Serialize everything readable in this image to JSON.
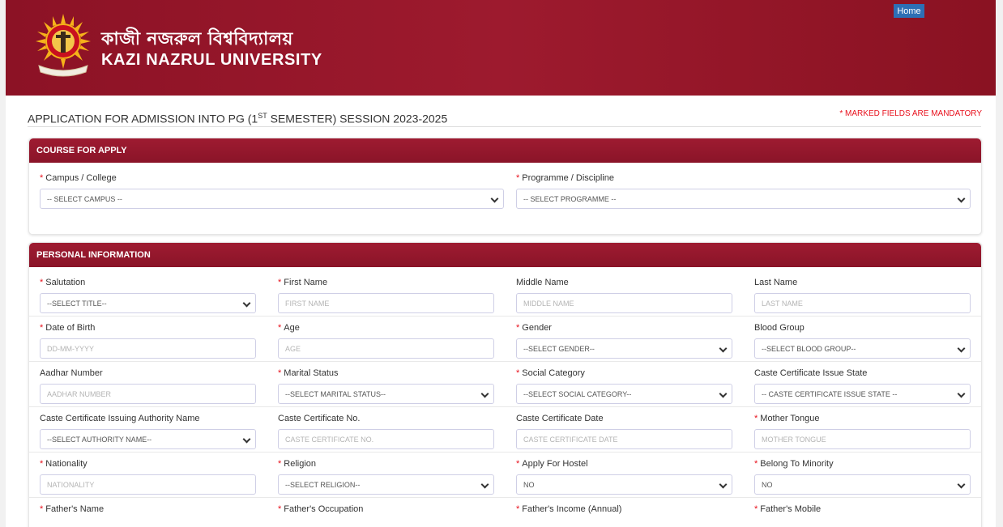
{
  "header": {
    "university_bengali": "কাজী নজরুল বিশ্ববিদ্যালয়",
    "university_english": "KAZI NAZRUL UNIVERSITY",
    "home_button": "Home",
    "logo_icon": "university-emblem"
  },
  "page": {
    "title_prefix": "APPLICATION FOR ADMISSION INTO PG (1",
    "title_sup": "ST",
    "title_suffix": " SEMESTER) SESSION 2023-2025",
    "mandatory_note": "* MARKED FIELDS ARE MANDATORY"
  },
  "course": {
    "heading": "COURSE FOR APPLY",
    "campus_label": "Campus / College",
    "campus_value": "-- SELECT CAMPUS --",
    "programme_label": "Programme / Discipline",
    "programme_value": "-- SELECT PROGRAMME --"
  },
  "personal": {
    "heading": "PERSONAL INFORMATION",
    "salutation_label": "Salutation",
    "salutation_value": "--SELECT TITLE--",
    "first_name_label": "First Name",
    "first_name_placeholder": "FIRST NAME",
    "middle_name_label": "Middle Name",
    "middle_name_placeholder": "MIDDLE NAME",
    "last_name_label": "Last Name",
    "last_name_placeholder": "LAST NAME",
    "dob_label": "Date of Birth",
    "dob_placeholder": "DD-MM-YYYY",
    "age_label": "Age",
    "age_placeholder": "AGE",
    "gender_label": "Gender",
    "gender_value": "--SELECT GENDER--",
    "blood_label": "Blood Group",
    "blood_value": "--SELECT BLOOD GROUP--",
    "aadhar_label": "Aadhar Number",
    "aadhar_placeholder": "AADHAR NUMBER",
    "marital_label": "Marital Status",
    "marital_value": "--SELECT MARITAL STATUS--",
    "social_label": "Social Category",
    "social_value": "--SELECT SOCIAL CATEGORY--",
    "caste_state_label": "Caste Certificate Issue State",
    "caste_state_value": "-- CASTE CERTIFICATE ISSUE STATE --",
    "authority_label": "Caste Certificate Issuing Authority Name",
    "authority_value": "--SELECT AUTHORITY NAME--",
    "caste_no_label": "Caste Certificate No.",
    "caste_no_placeholder": "CASTE CERTIFICATE NO.",
    "caste_date_label": "Caste Certificate Date",
    "caste_date_placeholder": "CASTE CERTIFICATE DATE",
    "mother_tongue_label": "Mother Tongue",
    "mother_tongue_placeholder": "MOTHER TONGUE",
    "nationality_label": "Nationality",
    "nationality_placeholder": "NATIONALITY",
    "religion_label": "Religion",
    "religion_value": "--SELECT RELIGION--",
    "hostel_label": "Apply For Hostel",
    "hostel_value": "NO",
    "minority_label": "Belong To Minority",
    "minority_value": "NO",
    "father_name_label": "Father's Name",
    "father_occupation_label": "Father's Occupation",
    "father_income_label": "Father's Income (Annual)",
    "father_mobile_label": "Father's Mobile"
  },
  "colors": {
    "header_maroon": "#8c1225",
    "panel_head": "#9e1b31",
    "required_red": "#e8101c",
    "home_blue": "#2d6fb5"
  }
}
